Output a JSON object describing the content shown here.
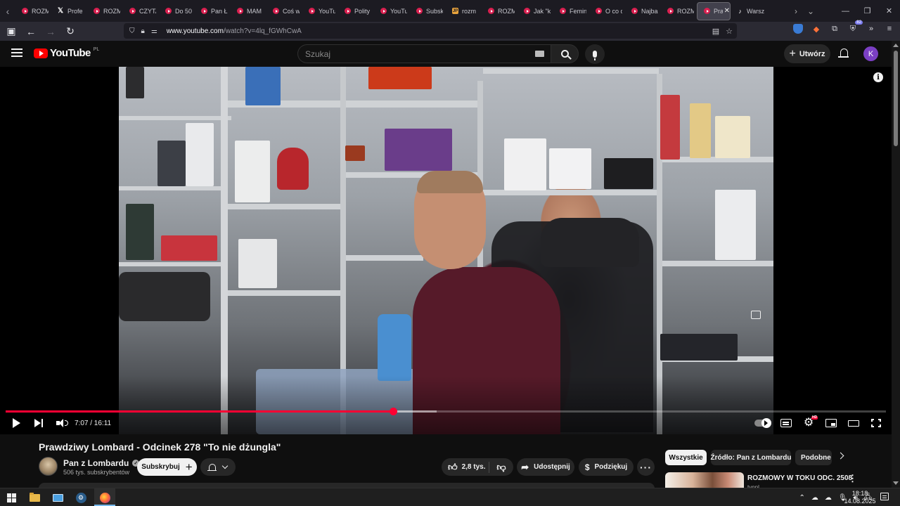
{
  "browser": {
    "tabs": [
      {
        "label": "ROZM",
        "favicon": "youtube"
      },
      {
        "label": "Profe",
        "favicon": "x"
      },
      {
        "label": "ROZM",
        "favicon": "youtube"
      },
      {
        "label": "CZYTA",
        "favicon": "youtube"
      },
      {
        "label": "Do 50",
        "favicon": "youtube"
      },
      {
        "label": "Pan Ł",
        "favicon": "youtube"
      },
      {
        "label": "MAM",
        "favicon": "youtube"
      },
      {
        "label": "Coś w",
        "favicon": "youtube"
      },
      {
        "label": "YouTu",
        "favicon": "youtube"
      },
      {
        "label": "Polity",
        "favicon": "youtube"
      },
      {
        "label": "YouTu",
        "favicon": "youtube"
      },
      {
        "label": "Subsk",
        "favicon": "youtube"
      },
      {
        "label": "rozm",
        "favicon": "jp"
      },
      {
        "label": "ROZM",
        "favicon": "youtube"
      },
      {
        "label": "Jak \"k",
        "favicon": "youtube"
      },
      {
        "label": "Femin",
        "favicon": "youtube"
      },
      {
        "label": "O co c",
        "favicon": "youtube"
      },
      {
        "label": "Najba",
        "favicon": "youtube"
      },
      {
        "label": "ROZM",
        "favicon": "youtube"
      },
      {
        "label": "Pra",
        "favicon": "youtube",
        "active": true
      },
      {
        "label": "Warsz",
        "favicon": "tiktok"
      }
    ],
    "url_host": "www.youtube.com",
    "url_path": "/watch?v=4lq_fGWhCwA",
    "extension_badge": "82"
  },
  "youtube": {
    "logo_text": "YouTube",
    "country_code": "PL",
    "search_placeholder": "Szukaj",
    "create_label": "Utwórz",
    "avatar_letter": "K"
  },
  "player": {
    "time_current": "7:07",
    "time_total": "16:11",
    "time_display": "7:07 / 16:11",
    "progress_fraction": 0.44,
    "buffer_fraction": 0.49,
    "hd_badge": "HD"
  },
  "video": {
    "title": "Prawdziwy Lombard - Odcinek 278 \"To nie dżungla\"",
    "channel_name": "Pan z Lombardu",
    "subscribers": "506 tys. subskrybentów",
    "subscribe_label": "Subskrybuj",
    "likes": "2,8 tys.",
    "share_label": "Udostępnij",
    "thanks_label": "Podziękuj"
  },
  "sidebar": {
    "chips": [
      "Wszystkie",
      "Źródło: Pan z Lombardu",
      "Podobne"
    ],
    "recommendation": {
      "title": "ROZMOWY W TOKU ODC. 2508",
      "channel": "tvnpl"
    }
  },
  "taskbar": {
    "time": "18:18",
    "date": "14.08.2025"
  },
  "colors": {
    "accent": "#ff0033",
    "background": "#0f0f0f",
    "pill": "#272727"
  }
}
